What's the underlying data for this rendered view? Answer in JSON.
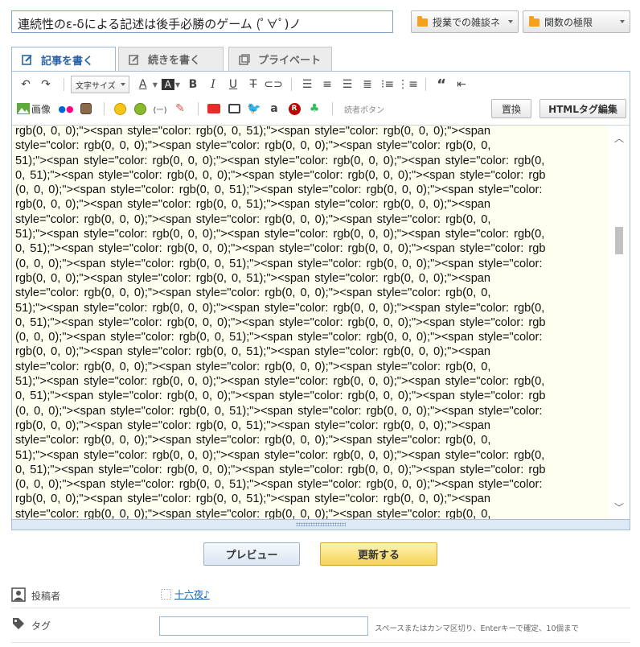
{
  "title_value": "連続性のε-δによる記述は後手必勝のゲーム (ﾟ∀ﾟ)ノ",
  "categories": {
    "first": "授業での雑談ネ",
    "second": "関数の極限"
  },
  "tabs": [
    {
      "label": "記事を書く",
      "icon": "edit-icon"
    },
    {
      "label": "続きを書く",
      "icon": "edit-more-icon"
    },
    {
      "label": "プライベート",
      "icon": "private-icon"
    }
  ],
  "toolbar": {
    "font_size_label": "文字サイズ",
    "image_label": "画像",
    "reader_button_label": "読者ボタン",
    "replace_label": "置換",
    "html_edit_label": "HTMLタグ編集",
    "icons_row1": [
      "undo-icon",
      "redo-icon",
      "font-size-dropdown",
      "font-color-icon",
      "background-color-icon",
      "bold-icon",
      "italic-icon",
      "underline-icon",
      "strikethrough-icon",
      "link-icon",
      "align-left-icon",
      "align-center-icon",
      "align-right-icon",
      "justify-icon",
      "bullet-list-icon",
      "numbered-list-icon",
      "quote-icon",
      "indent-icon"
    ],
    "icons_row2": [
      "image-icon",
      "flickr-icon",
      "instagram-icon",
      "emoji-icon",
      "sticker-icon",
      "rubi-icon",
      "pen-icon",
      "youtube-icon",
      "niconico-icon",
      "twitter-icon",
      "amazon-icon",
      "rakuten-icon",
      "evernote-icon"
    ]
  },
  "editor": {
    "code_lines": [
      "rgb(0, 0, 0);\"><span style=\"color: rgb(0, 0, 51);\"><span style=\"color: rgb(0, 0, 0);\"><span",
      "style=\"color: rgb(0, 0, 0);\"><span style=\"color: rgb(0, 0, 0);\"><span style=\"color: rgb(0, 0,",
      "51);\"><span style=\"color: rgb(0, 0, 0);\"><span style=\"color: rgb(0, 0, 0);\"><span style=\"color: rgb(0,",
      "0, 51);\"><span style=\"color: rgb(0, 0, 0);\"><span style=\"color: rgb(0, 0, 0);\"><span style=\"color: rgb",
      "(0, 0, 0);\"><span style=\"color: rgb(0, 0, 51);\"><span style=\"color: rgb(0, 0, 0);\"><span style=\"color:",
      "rgb(0, 0, 0);\"><span style=\"color: rgb(0, 0, 51);\"><span style=\"color: rgb(0, 0, 0);\"><span",
      "style=\"color: rgb(0, 0, 0);\"><span style=\"color: rgb(0, 0, 0);\"><span style=\"color: rgb(0, 0,",
      "51);\"><span style=\"color: rgb(0, 0, 0);\"><span style=\"color: rgb(0, 0, 0);\"><span style=\"color: rgb(0,",
      "0, 51);\"><span style=\"color: rgb(0, 0, 0);\"><span style=\"color: rgb(0, 0, 0);\"><span style=\"color: rgb",
      "(0, 0, 0);\"><span style=\"color: rgb(0, 0, 51);\"><span style=\"color: rgb(0, 0, 0);\"><span style=\"color:",
      "rgb(0, 0, 0);\"><span style=\"color: rgb(0, 0, 51);\"><span style=\"color: rgb(0, 0, 0);\"><span",
      "style=\"color: rgb(0, 0, 0);\"><span style=\"color: rgb(0, 0, 0);\"><span style=\"color: rgb(0, 0,",
      "51);\"><span style=\"color: rgb(0, 0, 0);\"><span style=\"color: rgb(0, 0, 0);\"><span style=\"color: rgb(0,",
      "0, 51);\"><span style=\"color: rgb(0, 0, 0);\"><span style=\"color: rgb(0, 0, 0);\"><span style=\"color: rgb",
      "(0, 0, 0);\"><span style=\"color: rgb(0, 0, 51);\"><span style=\"color: rgb(0, 0, 0);\"><span style=\"color:",
      "rgb(0, 0, 0);\"><span style=\"color: rgb(0, 0, 51);\"><span style=\"color: rgb(0, 0, 0);\"><span",
      "style=\"color: rgb(0, 0, 0);\"><span style=\"color: rgb(0, 0, 0);\"><span style=\"color: rgb(0, 0,",
      "51);\"><span style=\"color: rgb(0, 0, 0);\"><span style=\"color: rgb(0, 0, 0);\"><span style=\"color: rgb(0,",
      "0, 51);\"><span style=\"color: rgb(0, 0, 0);\"><span style=\"color: rgb(0, 0, 0);\"><span style=\"color: rgb",
      "(0, 0, 0);\"><span style=\"color: rgb(0, 0, 51);\"><span style=\"color: rgb(0, 0, 0);\"><span style=\"color:",
      "rgb(0, 0, 0);\"><span style=\"color: rgb(0, 0, 51);\"><span style=\"color: rgb(0, 0, 0);\"><span",
      "style=\"color: rgb(0, 0, 0);\"><span style=\"color: rgb(0, 0, 0);\"><span style=\"color: rgb(0, 0,",
      "51);\"><span style=\"color: rgb(0, 0, 0);\"><span style=\"color: rgb(0, 0, 0);\"><span style=\"color: rgb(0,",
      "0, 51);\"><span style=\"color: rgb(0, 0, 0);\"><span style=\"color: rgb(0, 0, 0);\"><span style=\"color: rgb",
      "(0, 0, 0);\"><span style=\"color: rgb(0, 0, 51);\"><span style=\"color: rgb(0, 0, 0);\"><span style=\"color:",
      "rgb(0, 0, 0);\"><span style=\"color: rgb(0, 0, 51);\"><span style=\"color: rgb(0, 0, 0);\"><span",
      "style=\"color: rgb(0, 0, 0);\"><span style=\"color: rgb(0, 0, 0);\"><span style=\"color: rgb(0, 0,"
    ]
  },
  "actions": {
    "preview_label": "プレビュー",
    "update_label": "更新する"
  },
  "meta": {
    "author_label": "投稿者",
    "author_name": "十六夜♪",
    "tag_label": "タグ",
    "tag_value": "",
    "tag_hint": "スペースまたはカンマ区切り、Enterキーで確定、10個まで"
  },
  "colors": {
    "accent_blue": "#2a63a8",
    "folder_orange": "#f5a11c",
    "editor_bg": "#fffff0",
    "update_button": "#f7d457"
  }
}
